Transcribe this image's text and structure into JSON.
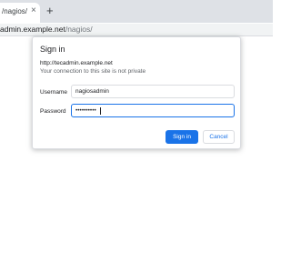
{
  "browser": {
    "tab": {
      "title": "/nagios/",
      "close_glyph": "×"
    },
    "new_tab_glyph": "+",
    "address": {
      "host": "admin.example.net",
      "path": "/nagios/"
    }
  },
  "dialog": {
    "title": "Sign in",
    "origin": "http://tecadmin.example.net",
    "warning": "Your connection to this site is not private",
    "username": {
      "label": "Username",
      "value": "nagiosadmin"
    },
    "password": {
      "label": "Password",
      "value": "••••••••••"
    },
    "signin_label": "Sign in",
    "cancel_label": "Cancel"
  },
  "colors": {
    "accent": "#1a73e8",
    "tabstrip": "#dee1e6"
  }
}
